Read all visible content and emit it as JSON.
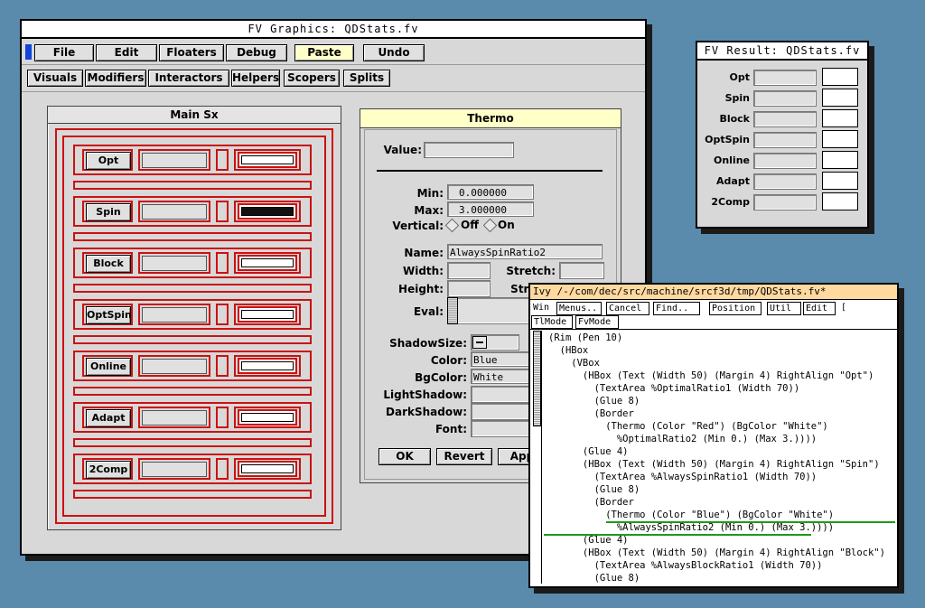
{
  "main_window": {
    "title": "FV Graphics: QDStats.fv",
    "menu": [
      "File",
      "Edit",
      "Floaters",
      "Debug",
      "Paste",
      "Undo"
    ],
    "toolbar": [
      "Visuals",
      "Modifiers",
      "Interactors",
      "Helpers",
      "Scopers",
      "Splits"
    ]
  },
  "main_sx": {
    "title": "Main Sx",
    "rows": [
      {
        "label": "Opt",
        "thermo_fill": 0
      },
      {
        "label": "Spin",
        "thermo_fill": 1
      },
      {
        "label": "Block",
        "thermo_fill": 0
      },
      {
        "label": "OptSpin",
        "thermo_fill": 0
      },
      {
        "label": "Online",
        "thermo_fill": 0
      },
      {
        "label": "Adapt",
        "thermo_fill": 0
      },
      {
        "label": "2Comp",
        "thermo_fill": 0
      }
    ]
  },
  "thermo_panel": {
    "title": "Thermo",
    "value_label": "Value:",
    "min_label": "Min:",
    "min_value": "0.000000",
    "max_label": "Max:",
    "max_value": "3.000000",
    "vertical_label": "Vertical:",
    "off_label": "Off",
    "on_label": "On",
    "name_label": "Name:",
    "name_value": "AlwaysSpinRatio2",
    "width_label": "Width:",
    "stretch_label": "Stretch:",
    "height_label": "Height:",
    "stretch2_label": "Stretch",
    "eval_label": "Eval:",
    "shadow_label": "ShadowSize:",
    "color_label": "Color:",
    "color_value": "Blue",
    "bgcolor_label": "BgColor:",
    "bgcolor_value": "White",
    "light_label": "LightShadow:",
    "dark_label": "DarkShadow:",
    "font_label": "Font:",
    "ok": "OK",
    "revert": "Revert",
    "apply": "Appl"
  },
  "result_window": {
    "title": "FV Result: QDStats.fv",
    "rows": [
      "Opt",
      "Spin",
      "Block",
      "OptSpin",
      "Online",
      "Adapt",
      "2Comp"
    ]
  },
  "ivy_window": {
    "title": "Ivy /-/com/dec/src/machine/srcf3d/tmp/QDStats.fv*",
    "toolbar": [
      "Win",
      "Menus..",
      "Cancel",
      "Find..",
      "Position",
      "Util",
      "Edit",
      "[",
      "TlMode",
      "FvMode"
    ],
    "code": [
      "(Rim (Pen 10)",
      "  (HBox",
      "    (VBox",
      "      (HBox (Text (Width 50) (Margin 4) RightAlign \"Opt\")",
      "        (TextArea %OptimalRatio1 (Width 70))",
      "        (Glue 8)",
      "        (Border",
      "          (Thermo (Color \"Red\") (BgColor \"White\")",
      "            %OptimalRatio2 (Min 0.) (Max 3.))))",
      "      (Glue 4)",
      "      (HBox (Text (Width 50) (Margin 4) RightAlign \"Spin\")",
      "        (TextArea %AlwaysSpinRatio1 (Width 70))",
      "        (Glue 8)",
      "        (Border",
      "          (Thermo (Color \"Blue\") (BgColor \"White\")",
      "            %AlwaysSpinRatio2 (Min 0.) (Max 3.))))",
      "      (Glue 4)",
      "      (HBox (Text (Width 50) (Margin 4) RightAlign \"Block\")",
      "        (TextArea %AlwaysBlockRatio1 (Width 70))",
      "        (Glue 8)"
    ]
  }
}
